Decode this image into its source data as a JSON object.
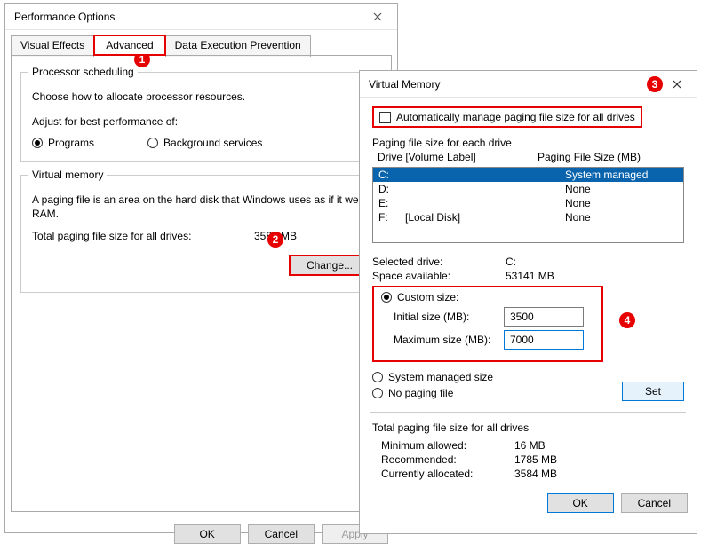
{
  "perf": {
    "title": "Performance Options",
    "tabs": [
      "Visual Effects",
      "Advanced",
      "Data Execution Prevention"
    ],
    "proc": {
      "legend": "Processor scheduling",
      "desc": "Choose how to allocate processor resources.",
      "adjust": "Adjust for best performance of:",
      "opt_programs": "Programs",
      "opt_bg": "Background services"
    },
    "vm": {
      "legend": "Virtual memory",
      "desc": "A paging file is an area on the hard disk that Windows uses as if it were RAM.",
      "total_label": "Total paging file size for all drives:",
      "total_value": "3584 MB",
      "change": "Change..."
    },
    "footer": {
      "ok": "OK",
      "cancel": "Cancel",
      "apply": "Apply"
    }
  },
  "vmem": {
    "title": "Virtual Memory",
    "auto": "Automatically manage paging file size for all drives",
    "each": "Paging file size for each drive",
    "head_drive": "Drive  [Volume Label]",
    "head_size": "Paging File Size (MB)",
    "drives": [
      {
        "letter": "C:",
        "label": "",
        "size": "System managed"
      },
      {
        "letter": "D:",
        "label": "",
        "size": "None"
      },
      {
        "letter": "E:",
        "label": "",
        "size": "None"
      },
      {
        "letter": "F:",
        "label": "[Local Disk]",
        "size": "None"
      }
    ],
    "selected_label": "Selected drive:",
    "selected_value": "C:",
    "space_label": "Space available:",
    "space_value": "53141 MB",
    "custom": "Custom size:",
    "initial_label": "Initial size (MB):",
    "initial_value": "3500",
    "max_label": "Maximum size (MB):",
    "max_value": "7000",
    "sys_managed": "System managed size",
    "no_paging": "No paging file",
    "set": "Set",
    "total_legend": "Total paging file size for all drives",
    "min_label": "Minimum allowed:",
    "min_value": "16 MB",
    "rec_label": "Recommended:",
    "rec_value": "1785 MB",
    "cur_label": "Currently allocated:",
    "cur_value": "3584 MB",
    "ok": "OK",
    "cancel": "Cancel"
  },
  "markers": {
    "m1": "1",
    "m2": "2",
    "m3": "3",
    "m4": "4"
  }
}
